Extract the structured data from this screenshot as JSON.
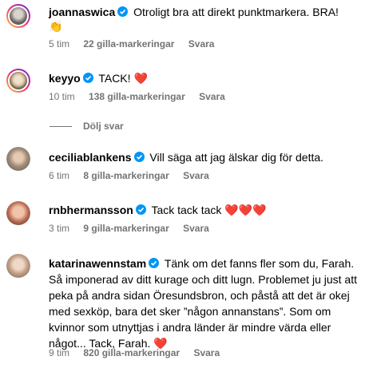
{
  "comments": [
    {
      "username": "joannaswica",
      "text": "Otroligt bra att direkt punktmarkera. BRA!",
      "emoji": "👏",
      "time": "5 tim",
      "likes": "22 gilla-markeringar",
      "reply": "Svara"
    },
    {
      "username": "keyyo",
      "text": "TACK!",
      "emoji": "❤️",
      "time": "10 tim",
      "likes": "138 gilla-markeringar",
      "reply": "Svara"
    },
    {
      "username": "ceciliablankens",
      "text": "Vill säga att jag älskar dig för detta.",
      "time": "6 tim",
      "likes": "8 gilla-markeringar",
      "reply": "Svara"
    },
    {
      "username": "rnbhermansson",
      "text": "Tack tack tack",
      "emoji": "❤️❤️❤️",
      "time": "3 tim",
      "likes": "9 gilla-markeringar",
      "reply": "Svara"
    },
    {
      "username": "katarinawennstam",
      "text": "Tänk om det fanns fler som du, Farah. Så imponerad av ditt kurage och ditt lugn. Problemet ju just att peka på andra sidan Öresundsbron, och påstå att det är okej med sexköp, bara det sker ”någon annanstans”. Som om kvinnor som utnyttjas i andra länder är mindre värda eller något... Tack, Farah.",
      "emoji": "❤️",
      "time": "9 tim",
      "likes": "820 gilla-markeringar",
      "reply": "Svara"
    }
  ],
  "hide_replies": "Dölj svar",
  "icons": {
    "verified": "verified-badge-icon"
  },
  "colors": {
    "verified": "#0095f6",
    "muted": "#737373"
  }
}
